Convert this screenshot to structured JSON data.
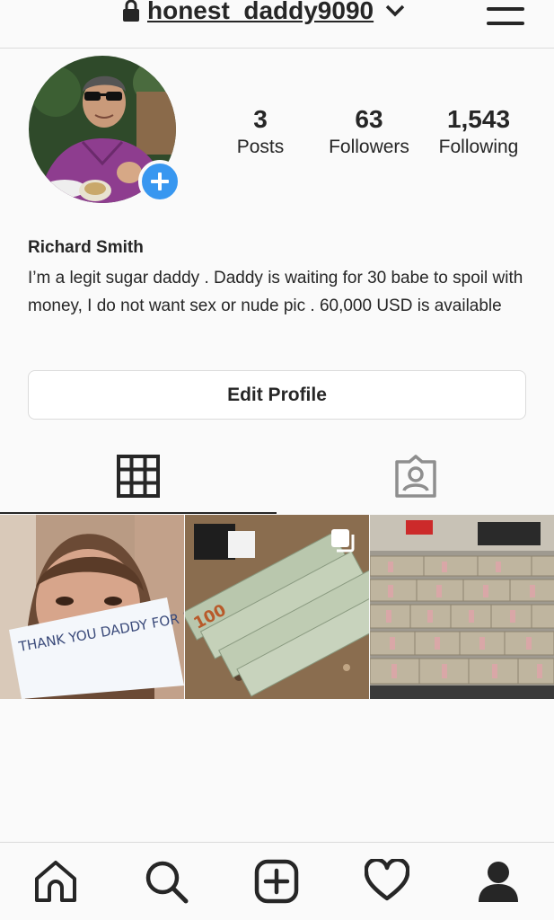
{
  "header": {
    "username": "honest_daddy9090"
  },
  "profile": {
    "name": "Richard Smith",
    "bio": "I’m a legit sugar daddy . Daddy is waiting for 30 babe to spoil with money, I do not want sex or nude pic . 60,000 USD is available",
    "stats": {
      "posts": {
        "value": "3",
        "label": "Posts"
      },
      "followers": {
        "value": "63",
        "label": "Followers"
      },
      "following": {
        "value": "1,543",
        "label": "Following"
      }
    },
    "edit_label": "Edit Profile"
  },
  "tabs": [
    "grid-icon",
    "tagged-icon"
  ],
  "posts": [
    {
      "icon": "handwritten-note-photo",
      "note_text": "THANK YOU DADDY FOR PAYING ME"
    },
    {
      "icon": "cash-stack-photo",
      "banknote_label": "100",
      "multiple": true
    },
    {
      "icon": "money-pallets-photo"
    }
  ],
  "bottom_nav": [
    "home-icon",
    "search-icon",
    "add-post-icon",
    "heart-icon",
    "profile-icon"
  ],
  "colors": {
    "accent": "#3897f0",
    "text": "#262626",
    "border": "#dbdbdb",
    "background": "#fafafa"
  }
}
